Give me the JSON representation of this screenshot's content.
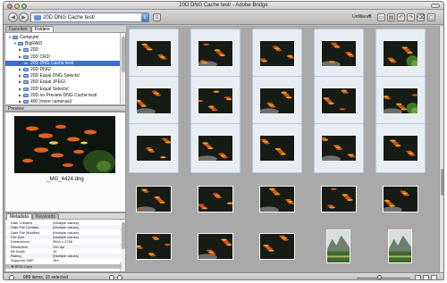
{
  "window": {
    "title": "20D DNG Cache test/ - Adobe Bridge"
  },
  "toolbar": {
    "back_glyph": "◀",
    "forward_glyph": "▶",
    "path": "20D DNG Cache test/",
    "path_dropdown_glyph": "⇕",
    "up_glyph": "⇧",
    "filter_value": "Unfiltered",
    "filter_arrow_glyph": "▾",
    "right_icons": [
      "new-folder-icon",
      "get-photos-icon",
      "rotate-left-icon",
      "rotate-right-icon",
      "delete-icon",
      "window-icon"
    ],
    "right_glyphs": [
      "▭",
      "▤",
      "↶",
      "↷",
      "⌫",
      "▢"
    ]
  },
  "left": {
    "tabs": [
      "Favorites",
      "Folders"
    ],
    "folders": [
      {
        "label": "Computer",
        "depth": 0,
        "expanded": true,
        "selected": false
      },
      {
        "label": "BigRAID",
        "depth": 1,
        "expanded": true,
        "selected": false
      },
      {
        "label": "20D",
        "depth": 2,
        "expanded": false,
        "selected": false
      },
      {
        "label": "20D CR2/",
        "depth": 2,
        "expanded": false,
        "selected": false
      },
      {
        "label": "20D DNG Cache test/",
        "depth": 2,
        "expanded": false,
        "selected": true
      },
      {
        "label": "20D DNG/",
        "depth": 2,
        "expanded": false,
        "selected": false
      },
      {
        "label": "20D Equal DNG Selects/",
        "depth": 2,
        "expanded": false,
        "selected": false
      },
      {
        "label": "20D Equal JPEG/",
        "depth": 2,
        "expanded": false,
        "selected": false
      },
      {
        "label": "20D Equal Selects/",
        "depth": 2,
        "expanded": false,
        "selected": false
      },
      {
        "label": "20D no Preview DNG Cache test/",
        "depth": 2,
        "expanded": false,
        "selected": false
      },
      {
        "label": "400 (more cameras)/",
        "depth": 2,
        "expanded": false,
        "selected": false
      }
    ],
    "preview_title": "Preview",
    "preview_caption": "_MG_4424.dng",
    "meta_tabs": [
      "Metadata",
      "Keywords"
    ],
    "metadata": [
      {
        "key": "Date Created",
        "value": "(Multiple values)"
      },
      {
        "key": "Date File Created",
        "value": "(Multiple values)"
      },
      {
        "key": "Date File Modified",
        "value": "(Multiple values)"
      },
      {
        "key": "File Size",
        "value": "(Multiple values)"
      },
      {
        "key": "Dimensions",
        "value": "3504 x 2336"
      },
      {
        "key": "Resolution",
        "value": "240 dpi"
      },
      {
        "key": "Bit Depth",
        "value": "16"
      },
      {
        "key": "Rating",
        "value": "(Multiple values)"
      },
      {
        "key": "Supports XMP",
        "value": "Yes"
      }
    ],
    "meta_section": "▼ IPTC Core"
  },
  "status": {
    "text": "989 items, 15 selected"
  },
  "thumbnails": [
    {
      "selected": true,
      "kind": "fish"
    },
    {
      "selected": true,
      "kind": "fish"
    },
    {
      "selected": true,
      "kind": "fish"
    },
    {
      "selected": true,
      "kind": "fish"
    },
    {
      "selected": true,
      "kind": "fish-plant"
    },
    {
      "selected": true,
      "kind": "fish"
    },
    {
      "selected": true,
      "kind": "fish"
    },
    {
      "selected": true,
      "kind": "fish"
    },
    {
      "selected": true,
      "kind": "fish"
    },
    {
      "selected": true,
      "kind": "fish-plant"
    },
    {
      "selected": true,
      "kind": "fish"
    },
    {
      "selected": true,
      "kind": "fish"
    },
    {
      "selected": true,
      "kind": "fish"
    },
    {
      "selected": true,
      "kind": "fish"
    },
    {
      "selected": true,
      "kind": "fish"
    },
    {
      "selected": false,
      "kind": "fish"
    },
    {
      "selected": false,
      "kind": "fish"
    },
    {
      "selected": false,
      "kind": "fish"
    },
    {
      "selected": false,
      "kind": "fish"
    },
    {
      "selected": false,
      "kind": "fish"
    },
    {
      "selected": false,
      "kind": "fish"
    },
    {
      "selected": false,
      "kind": "fish"
    },
    {
      "selected": false,
      "kind": "fish"
    },
    {
      "selected": false,
      "kind": "mountain"
    },
    {
      "selected": false,
      "kind": "mountain"
    }
  ],
  "colors": {
    "selection": "#3f6fcf",
    "content_bg": "#a9a9a9",
    "selected_cell": "#e7edf3"
  }
}
